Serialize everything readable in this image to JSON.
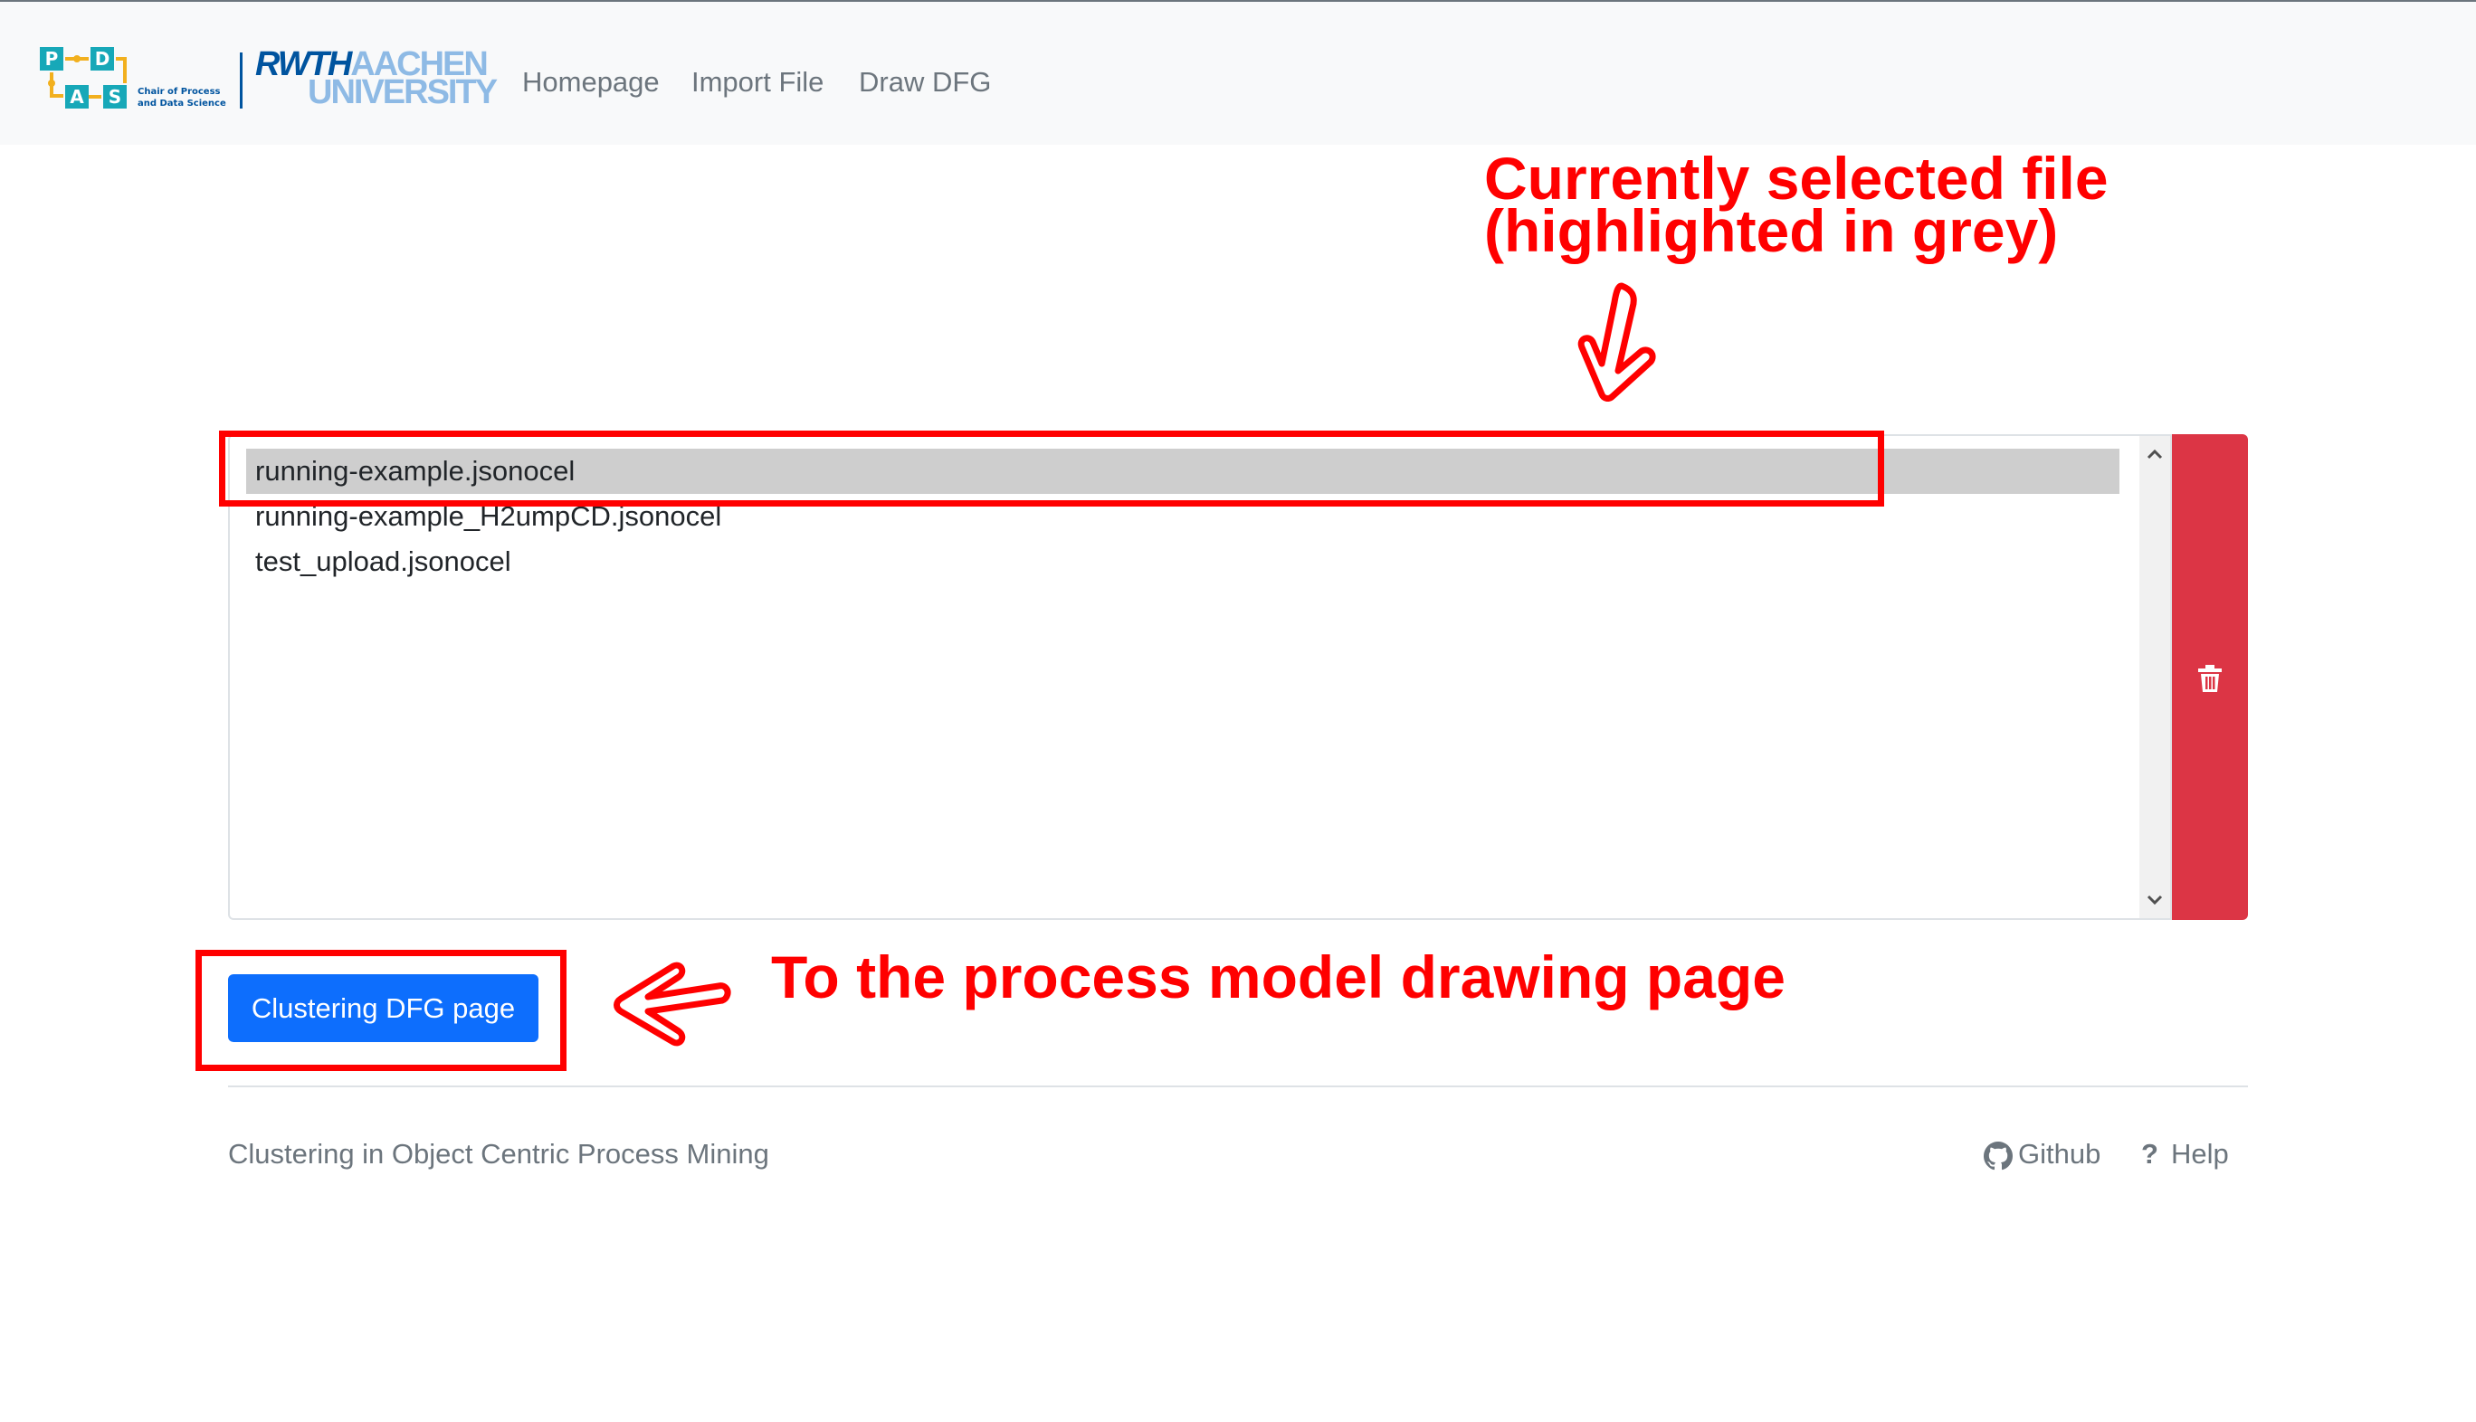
{
  "header": {
    "pads_logo": {
      "letters": [
        "P",
        "D",
        "A",
        "S"
      ],
      "tagline_line1": "Chair of Process",
      "tagline_line2": "and Data Science"
    },
    "rwth_logo": {
      "part1": "RWTH",
      "part2": "AACHEN",
      "part3": "UNIVERSITY"
    },
    "nav": {
      "homepage": "Homepage",
      "import_file": "Import File",
      "draw_dfg": "Draw DFG"
    }
  },
  "annotations": {
    "selected_line1": "Currently selected file",
    "selected_line2": "(highlighted in grey)",
    "button_note": "To the process model drawing page",
    "color": "#ff0000"
  },
  "file_list": {
    "items": [
      {
        "name": "running-example.jsonocel",
        "selected": true
      },
      {
        "name": "running-example_H2umpCD.jsonocel",
        "selected": false
      },
      {
        "name": "test_upload.jsonocel",
        "selected": false
      }
    ]
  },
  "delete_button": {
    "icon": "trash-icon",
    "color": "#dc3545"
  },
  "primary_button": {
    "label": "Clustering DFG page",
    "color": "#0d6efd"
  },
  "footer": {
    "text": "Clustering in Object Centric Process Mining",
    "github": "Github",
    "help_glyph": "?",
    "help": "Help"
  }
}
